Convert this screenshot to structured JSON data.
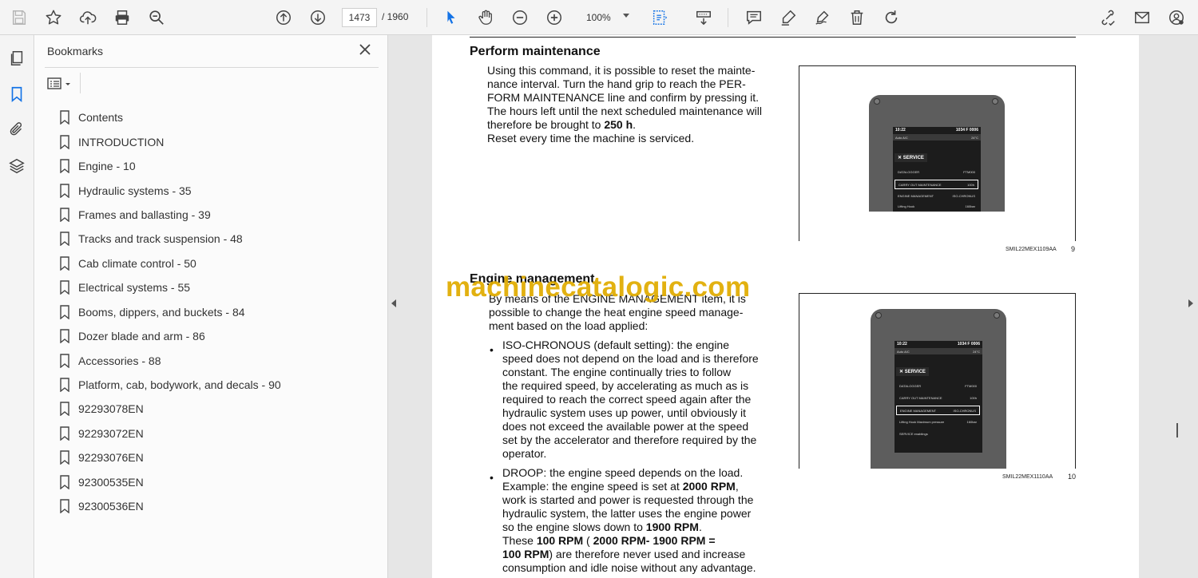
{
  "toolbar": {
    "current_page": "1473",
    "page_separator": "/ 1960",
    "zoom": "100%"
  },
  "bookmarks": {
    "title": "Bookmarks",
    "items": [
      "Contents",
      "INTRODUCTION",
      "Engine - 10",
      "Hydraulic systems - 35",
      "Frames and ballasting - 39",
      "Tracks and track suspension - 48",
      "Cab climate control - 50",
      "Electrical systems - 55",
      "Booms, dippers, and buckets - 84",
      "Dozer blade and arm - 86",
      "Accessories - 88",
      "Platform, cab, bodywork, and decals - 90",
      "92293078EN",
      "92293072EN",
      "92293076EN",
      "92300535EN",
      "92300536EN"
    ]
  },
  "document": {
    "section1": {
      "heading": "Perform maintenance",
      "lines": [
        "Using this command, it is possible to reset the mainte-",
        "nance interval. Turn the hand grip to reach the PER-",
        "FORM MAINTENANCE line and confirm by pressing it.",
        "The hours left until the next scheduled maintenance will",
        "therefore be brought to ",
        "250 h",
        ".",
        "Reset every time the machine is serviced."
      ]
    },
    "figure1": {
      "code": "SMIL22MEX1109AA",
      "number": "9",
      "screen": {
        "time": "10:22",
        "status": "1034 F 0006",
        "bar_left": "Auto  A/C",
        "bar_right": "24°C",
        "service_title": "SERVICE",
        "rows": [
          {
            "label": "DATALOGGER",
            "value": "FTM000"
          },
          {
            "label": "CARRY OUT MAINTENANCE",
            "value": "100h"
          },
          {
            "label": "ENGINE MANAGEMENT",
            "value": "ISO-CHRONUS"
          },
          {
            "label": "Lifting Hook",
            "value": "160bar"
          }
        ]
      }
    },
    "section2": {
      "heading": "Engine management",
      "intro": [
        "By means of the ENGINE MANAGEMENT item, it is",
        "possible to change the heat engine speed manage-",
        "ment based on the load applied:"
      ],
      "bullet1": [
        "ISO-CHRONOUS (default setting): the engine",
        "speed does not depend on the load and is therefore",
        "constant. The engine continually tries to follow",
        "the required speed, by accelerating as much as is",
        "required to reach the correct speed again after the",
        "hydraulic system uses up power, until obviously it",
        "does not exceed the available power at the speed",
        "set by the accelerator and therefore required by the",
        "operator."
      ],
      "bullet2_line1": "DROOP: the engine speed depends on the load.",
      "bullet2_line2a": "Example: the engine speed is set at ",
      "bullet2_line2b": "2000 RPM",
      "bullet2_line2c": ",",
      "bullet2_line3": "work is started and power is requested through the",
      "bullet2_line4": "hydraulic system, the latter uses the engine power",
      "bullet2_line5a": "so the engine slows down to ",
      "bullet2_line5b": "1900 RPM",
      "bullet2_line5c": ".",
      "bullet2_line6a": "These ",
      "bullet2_line6b": "100 RPM",
      "bullet2_line6c": " ( ",
      "bullet2_line6d": "2000 RPM- 1900 RPM =",
      "bullet2_line7a": "100 RPM",
      "bullet2_line7b": ") are therefore never used and increase",
      "bullet2_line8": "consumption and idle noise without any advantage.",
      "bullet_glyph": "•"
    },
    "figure2": {
      "code": "SMIL22MEX1110AA",
      "number": "10",
      "screen": {
        "time": "10:22",
        "status": "1034 F 0006",
        "bar_left": "Auto  A/C",
        "bar_right": "24°C",
        "service_title": "SERVICE",
        "rows": [
          {
            "label": "DATALOGGER",
            "value": "FTM000"
          },
          {
            "label": "CARRY OUT MAINTENANCE",
            "value": "100h"
          },
          {
            "label": "ENGINE MANAGEMENT",
            "value": "ISO-CHRONUS"
          },
          {
            "label": "Lifting Hook Maximum pressure",
            "value": "160bar"
          },
          {
            "label": "SERVICE enablings",
            "value": ""
          }
        ]
      }
    },
    "watermark": "machinecatalogic.com"
  },
  "icons": {
    "toolbar": [
      "save-icon",
      "bookmark-star-icon",
      "upload-icon",
      "print-icon",
      "zoom-search-icon",
      "prev-page-icon",
      "next-page-icon",
      "select-arrow-icon",
      "hand-icon",
      "zoom-out-icon",
      "zoom-in-icon",
      "fit-page-icon",
      "scroll-mode-icon",
      "comment-icon",
      "highlight-icon",
      "sign-icon",
      "delete-icon",
      "rotate-icon",
      "share-link-icon",
      "email-icon",
      "account-icon"
    ],
    "rail": [
      "pages-icon",
      "bookmarks-icon",
      "attachments-icon",
      "layers-icon"
    ]
  },
  "colors": {
    "accent": "#1473e6",
    "watermark": "#e0ac00"
  }
}
